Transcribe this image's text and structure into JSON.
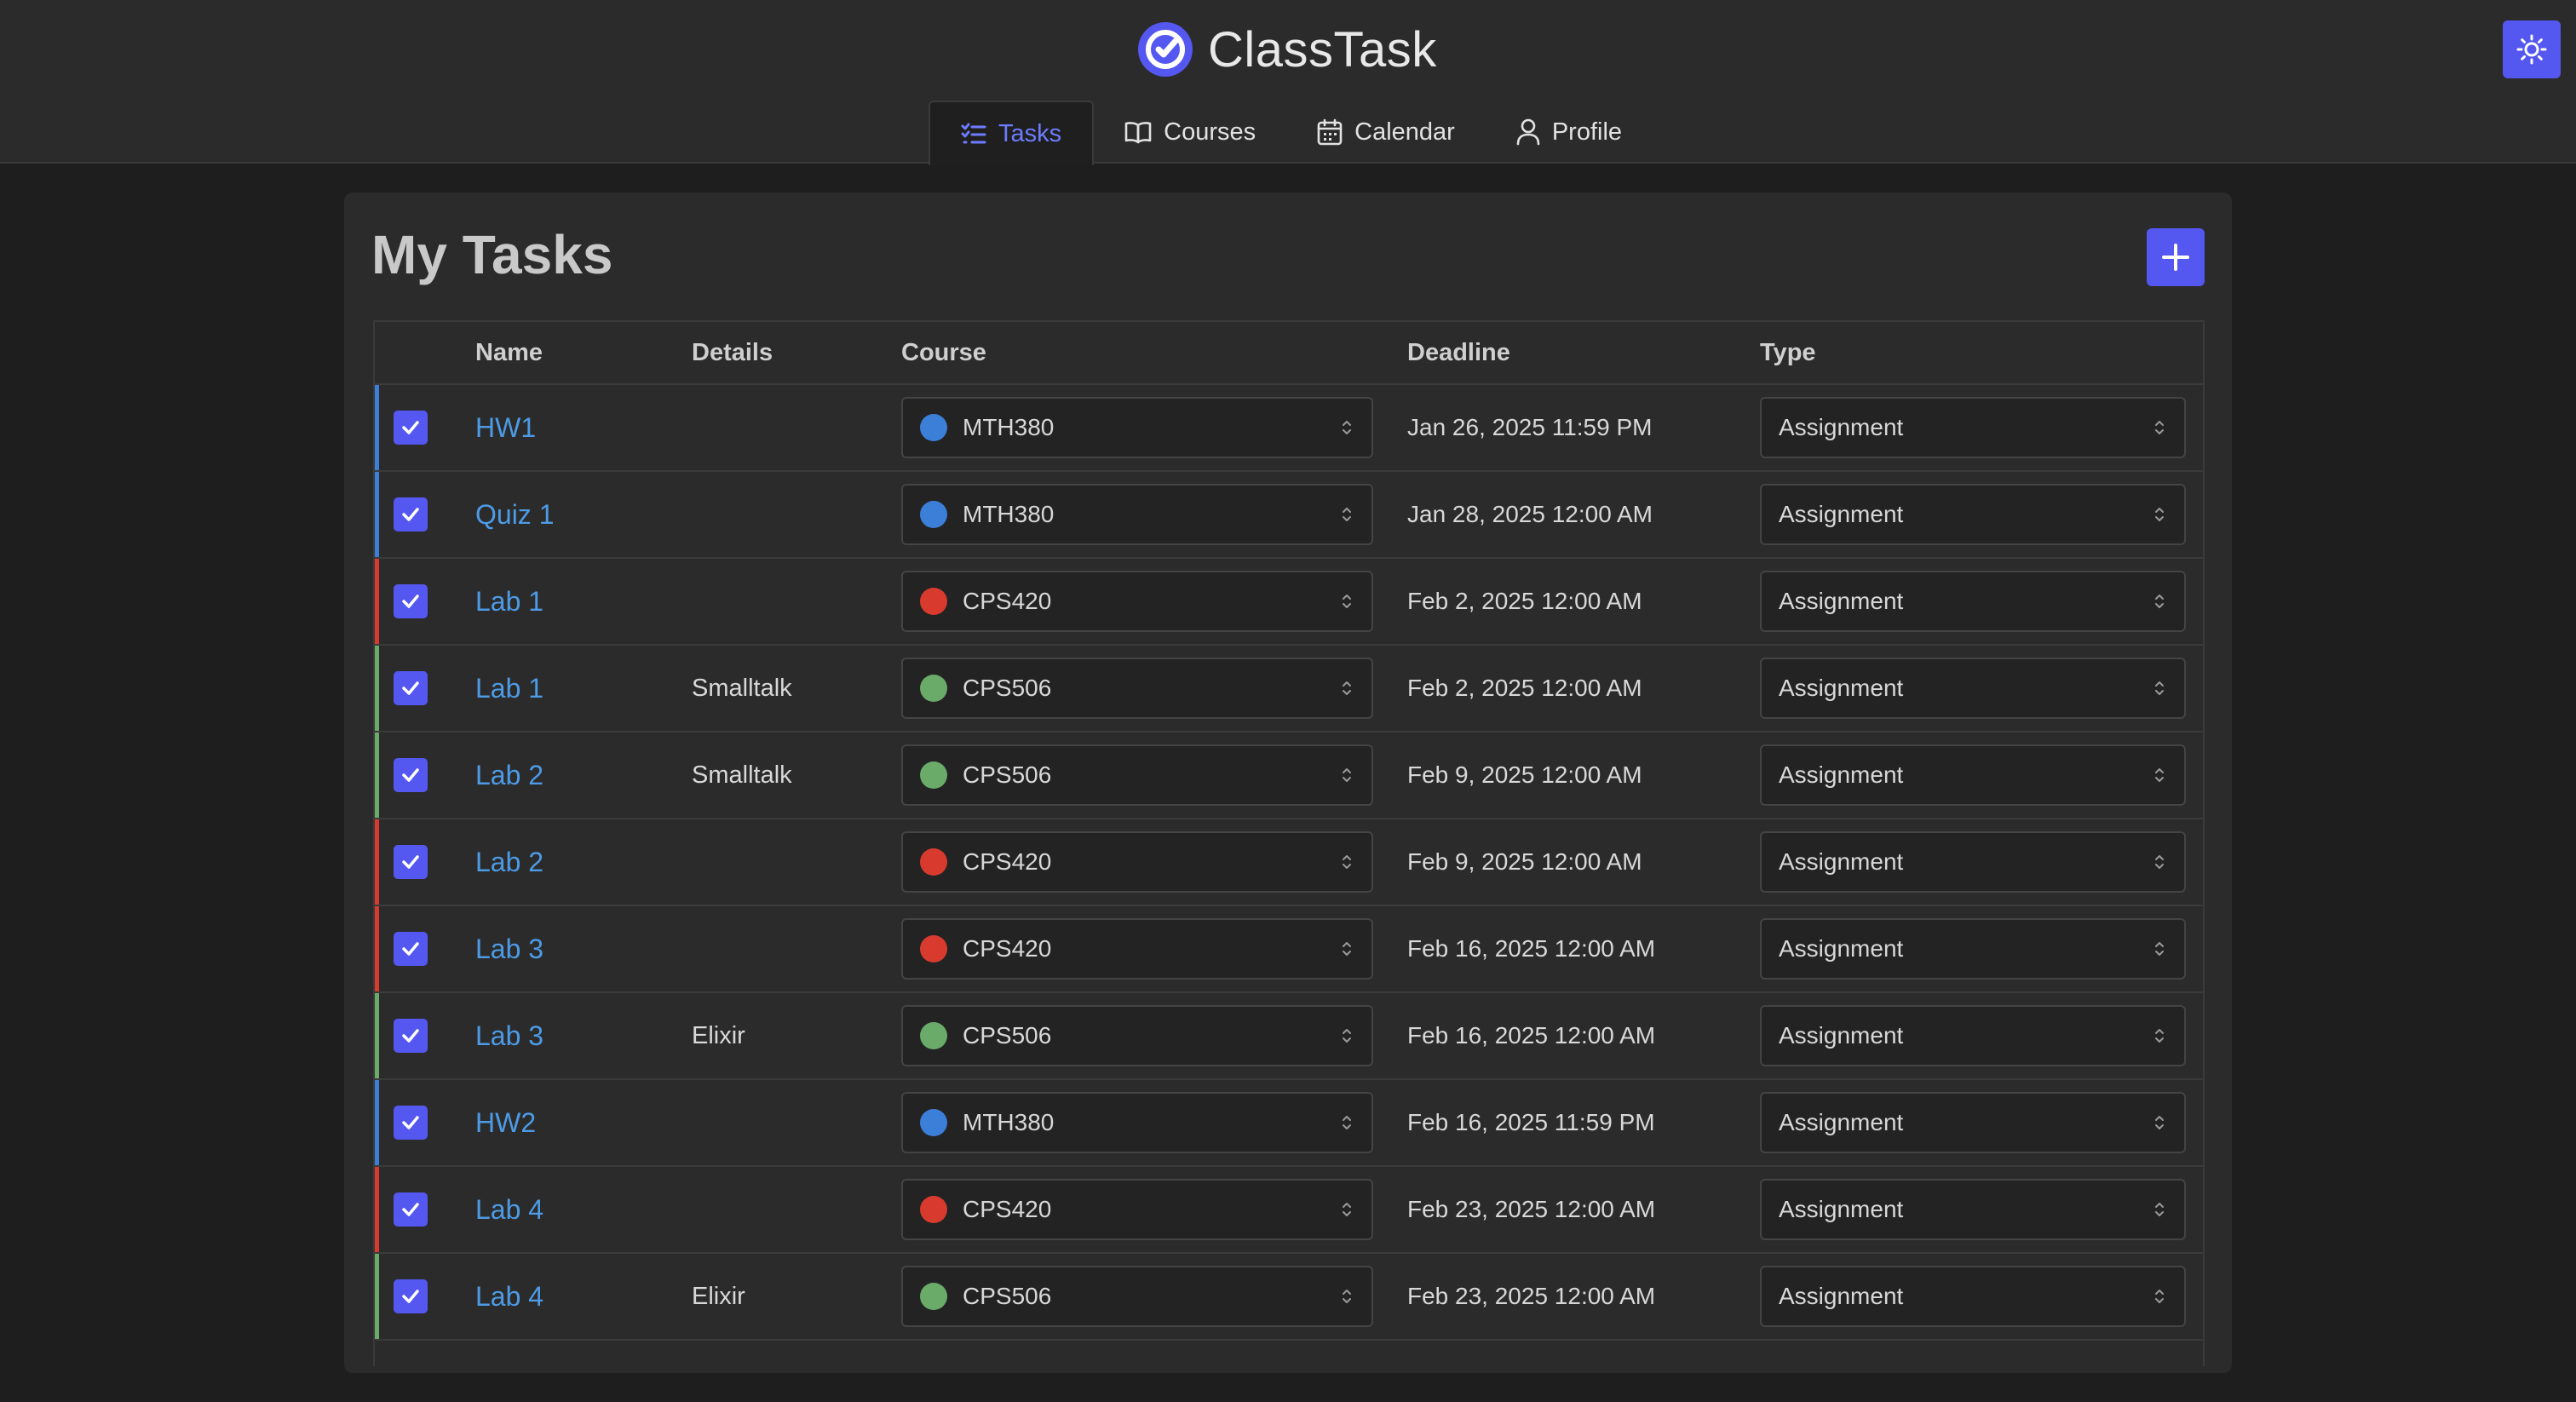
{
  "app": {
    "name": "ClassTask",
    "logo_icon": "check-badge-icon",
    "theme_toggle_icon": "sun-icon"
  },
  "nav": {
    "tabs": [
      {
        "label": "Tasks",
        "icon": "task-list-icon",
        "active": true
      },
      {
        "label": "Courses",
        "icon": "book-icon",
        "active": false
      },
      {
        "label": "Calendar",
        "icon": "calendar-icon",
        "active": false
      },
      {
        "label": "Profile",
        "icon": "user-icon",
        "active": false
      }
    ]
  },
  "colors": {
    "accent": "#5457f0",
    "link": "#4d9be6",
    "MTH380": "#3b7fd9",
    "CPS420": "#d93a2e",
    "CPS506": "#6aab6a"
  },
  "main": {
    "title": "My Tasks",
    "add_button_icon": "plus-icon",
    "columns": [
      "",
      "Name",
      "Details",
      "Course",
      "Deadline",
      "Type"
    ],
    "tasks": [
      {
        "done": true,
        "name": "HW1",
        "details": "",
        "course": "MTH380",
        "deadline": "Jan 26, 2025 11:59 PM",
        "type": "Assignment"
      },
      {
        "done": true,
        "name": "Quiz 1",
        "details": "",
        "course": "MTH380",
        "deadline": "Jan 28, 2025 12:00 AM",
        "type": "Assignment"
      },
      {
        "done": true,
        "name": "Lab 1",
        "details": "",
        "course": "CPS420",
        "deadline": "Feb 2, 2025 12:00 AM",
        "type": "Assignment"
      },
      {
        "done": true,
        "name": "Lab 1",
        "details": "Smalltalk",
        "course": "CPS506",
        "deadline": "Feb 2, 2025 12:00 AM",
        "type": "Assignment"
      },
      {
        "done": true,
        "name": "Lab 2",
        "details": "Smalltalk",
        "course": "CPS506",
        "deadline": "Feb 9, 2025 12:00 AM",
        "type": "Assignment"
      },
      {
        "done": true,
        "name": "Lab 2",
        "details": "",
        "course": "CPS420",
        "deadline": "Feb 9, 2025 12:00 AM",
        "type": "Assignment"
      },
      {
        "done": true,
        "name": "Lab 3",
        "details": "",
        "course": "CPS420",
        "deadline": "Feb 16, 2025 12:00 AM",
        "type": "Assignment"
      },
      {
        "done": true,
        "name": "Lab 3",
        "details": "Elixir",
        "course": "CPS506",
        "deadline": "Feb 16, 2025 12:00 AM",
        "type": "Assignment"
      },
      {
        "done": true,
        "name": "HW2",
        "details": "",
        "course": "MTH380",
        "deadline": "Feb 16, 2025 11:59 PM",
        "type": "Assignment"
      },
      {
        "done": true,
        "name": "Lab 4",
        "details": "",
        "course": "CPS420",
        "deadline": "Feb 23, 2025 12:00 AM",
        "type": "Assignment"
      },
      {
        "done": true,
        "name": "Lab 4",
        "details": "Elixir",
        "course": "CPS506",
        "deadline": "Feb 23, 2025 12:00 AM",
        "type": "Assignment"
      }
    ]
  }
}
